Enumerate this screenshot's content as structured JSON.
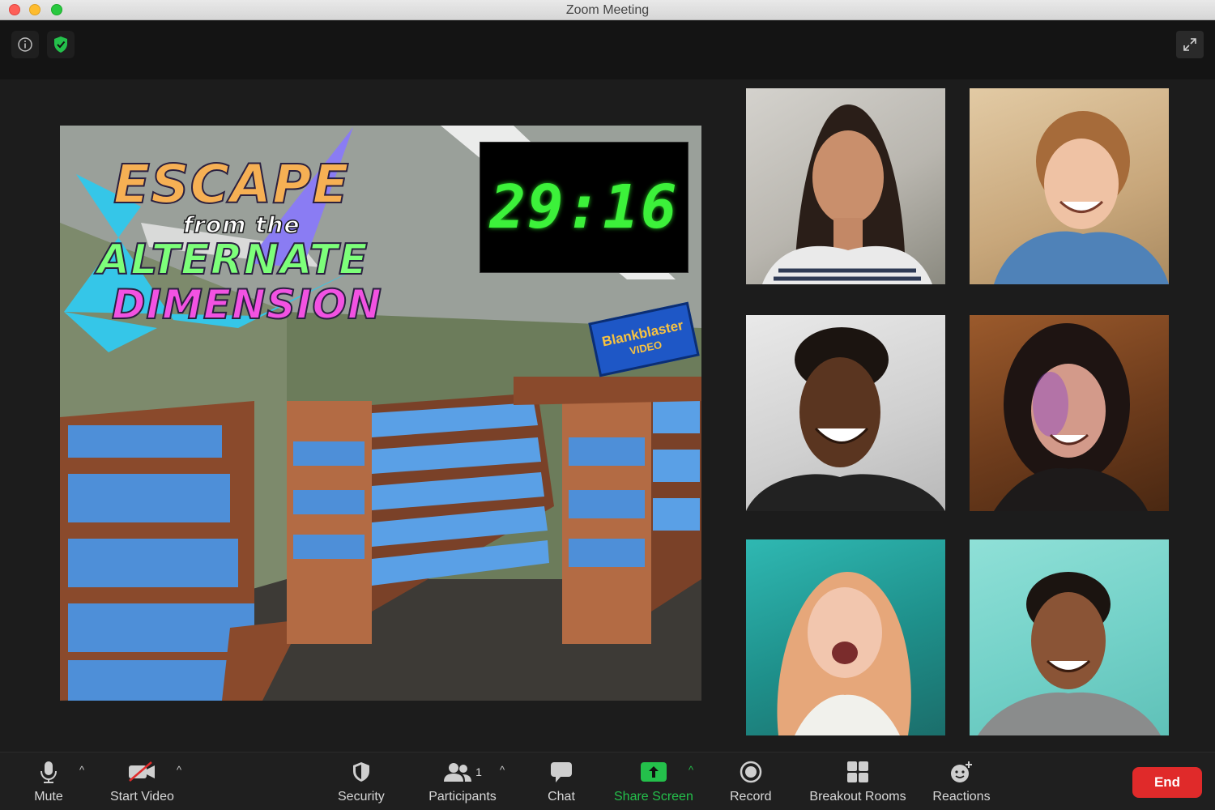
{
  "window": {
    "title": "Zoom Meeting"
  },
  "shared_screen": {
    "timer": "29:16",
    "title_lines": [
      "ESCAPE",
      "from the",
      "ALTERNATE",
      "DIMENSION"
    ],
    "store_sign": {
      "main": "Blankblaster",
      "sub": "VIDEO"
    }
  },
  "toolbar": {
    "mute_label": "Mute",
    "start_video_label": "Start Video",
    "security_label": "Security",
    "participants_label": "Participants",
    "participants_count": "1",
    "chat_label": "Chat",
    "share_screen_label": "Share Screen",
    "record_label": "Record",
    "breakout_rooms_label": "Breakout Rooms",
    "reactions_label": "Reactions",
    "end_label": "End"
  },
  "colors": {
    "share_green": "#24c04b",
    "end_red": "#e02a2a",
    "timer_green": "#3cf13a"
  },
  "icons": [
    "info-icon",
    "shield-check-icon",
    "fullscreen-icon",
    "microphone-icon",
    "video-off-icon",
    "shield-icon",
    "participants-icon",
    "chat-icon",
    "share-screen-icon",
    "record-icon",
    "breakout-rooms-icon",
    "reactions-icon"
  ]
}
